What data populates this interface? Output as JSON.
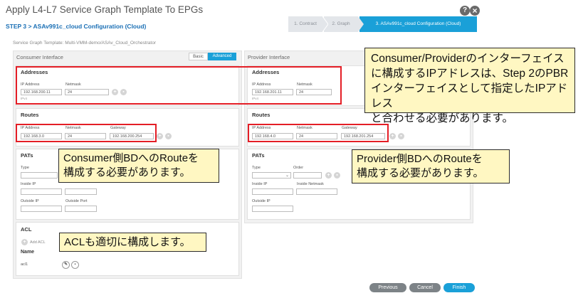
{
  "header": {
    "title": "Apply L4-L7 Service Graph Template To EPGs",
    "help_icon": "?",
    "close_icon": "×",
    "step_title": "STEP 3 > ASAv991c_cloud Configuration (Cloud)",
    "wizard": [
      "1. Contract",
      "2. Graph",
      "3. ASAv991c_cloud Configuration (Cloud)"
    ]
  },
  "template": {
    "label": "Service Graph Template:",
    "value": "Multi-VMM-demo/ASAv_Cloud_Orchestrator"
  },
  "consumer": {
    "heading": "Consumer Interface",
    "toggle": {
      "basic": "Basic",
      "advanced": "Advanced"
    },
    "addresses": {
      "title": "Addresses",
      "ip_label": "IP Address",
      "mask_label": "Netmask",
      "ip": "192.168.200.11",
      "mask": "24",
      "hint": "IPv4"
    },
    "routes": {
      "title": "Routes",
      "ip_label": "IP Address",
      "mask_label": "Netmask",
      "gw_label": "Gateway",
      "ip": "192.168.3.0",
      "mask": "24",
      "gw": "192.168.200.254"
    },
    "pats": {
      "title": "PATs",
      "type_label": "Type",
      "inside_ip": "Inside IP",
      "outside_ip": "Outside IP",
      "outside_port": "Outside Port"
    },
    "acl": {
      "title": "ACL",
      "add_label": "Add ACL",
      "name_header": "Name",
      "row_name": "acl1"
    }
  },
  "provider": {
    "heading": "Provider Interface",
    "addresses": {
      "title": "Addresses",
      "ip_label": "IP Address",
      "mask_label": "Netmask",
      "ip": "192.168.201.11",
      "mask": "24",
      "hint": "IPv4"
    },
    "routes": {
      "title": "Routes",
      "ip_label": "IP Address",
      "mask_label": "Netmask",
      "gw_label": "Gateway",
      "ip": "192.168.4.0",
      "mask": "24",
      "gw": "192.168.201.254"
    },
    "pats": {
      "title": "PATs",
      "type_label": "Type",
      "order_label": "Order",
      "inside_ip": "Inside IP",
      "inside_netmask": "Inside Netmask",
      "outside_ip": "Outside IP"
    }
  },
  "callouts": {
    "top_right": [
      "Consumer/Providerのインターフェイス",
      "に構成するIPアドレスは、Step 2のPBR",
      "インターフェイスとして指定したIPアドレス",
      "と合わせる必要があります。"
    ],
    "consumer_route": [
      "Consumer側BDへのRouteを",
      "構成する必要があります。"
    ],
    "provider_route": [
      "Provider側BDへのRouteを",
      "構成する必要があります。"
    ],
    "acl": [
      "ACLも適切に構成します。"
    ]
  },
  "footer": {
    "previous": "Previous",
    "cancel": "Cancel",
    "finish": "Finish"
  },
  "colors": {
    "accent": "#1aa0d8",
    "highlight": "#e41e26",
    "callout_bg": "#fff7c2"
  }
}
